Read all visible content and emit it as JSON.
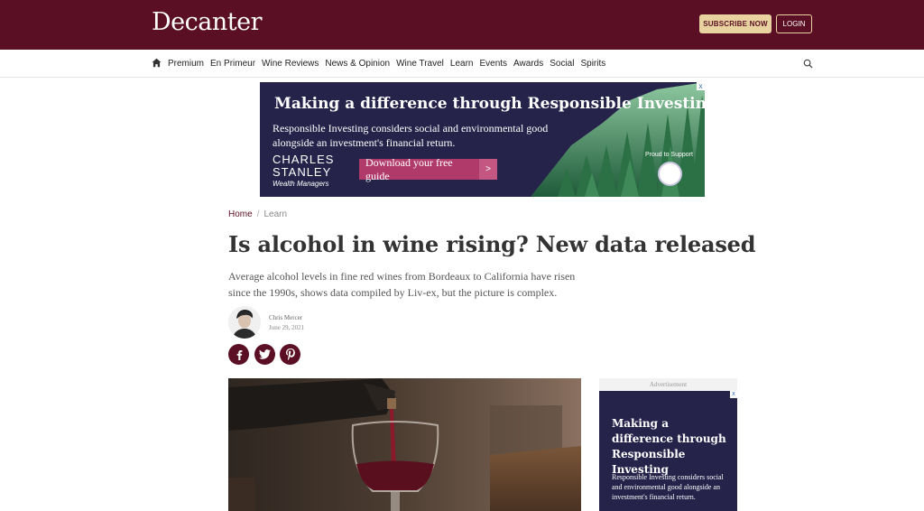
{
  "header": {
    "logo": "Decanter",
    "subscribe_label": "SUBSCRIBE NOW",
    "login_label": "LOGIN"
  },
  "nav": {
    "items": [
      "Premium",
      "En Primeur",
      "Wine Reviews",
      "News & Opinion",
      "Wine Travel",
      "Learn",
      "Events",
      "Awards",
      "Social",
      "Spirits"
    ]
  },
  "banner_ad": {
    "title": "Making a difference through Responsible Investing",
    "body": "Responsible Investing considers social and environmental good alongside an investment's financial return.",
    "brand_line1": "CHARLES",
    "brand_line2": "STANLEY",
    "brand_sub": "Wealth Managers",
    "cta_label": "Download your free guide",
    "cta_arrow": ">",
    "proud": "Proud to Support",
    "close": "x"
  },
  "breadcrumb": {
    "home": "Home",
    "sep": "/",
    "section": "Learn"
  },
  "article": {
    "title": "Is alcohol in wine rising? New data released",
    "standfirst": "Average alcohol levels in fine red wines from Bordeaux to California have risen since the 1990s, shows data compiled by Liv-ex, but the picture is complex.",
    "author": "Chris Mercer",
    "date": "June 29, 2021"
  },
  "sidebar_ad": {
    "label": "Advertisement",
    "title": "Making a difference through Responsible Investing",
    "body": "Responsible Investing considers social and environmental good alongside an investment's financial return.",
    "close": "x"
  },
  "colors": {
    "brand": "#5b0f24",
    "gold": "#e8d3a0",
    "ad_navy": "#26234a",
    "cta_pink": "#b03a6a"
  }
}
